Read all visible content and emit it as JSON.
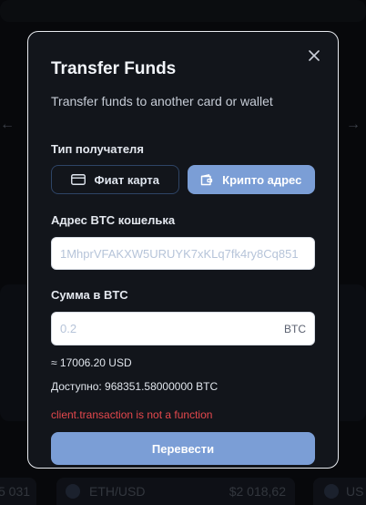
{
  "background": {
    "ticker_left": "5 031",
    "ticker_pair": "ETH/USD",
    "ticker_price": "$2 018,62",
    "ticker_right": "US"
  },
  "modal": {
    "title": "Transfer Funds",
    "subtitle": "Transfer funds to another card or wallet",
    "recipient_type_label": "Тип получателя",
    "type_options": [
      {
        "label": "Фиат карта",
        "icon": "credit-card-icon",
        "selected": false
      },
      {
        "label": "Крипто адрес",
        "icon": "wallet-icon",
        "selected": true
      }
    ],
    "address_label": "Адрес BTC кошелька",
    "address_placeholder": "1MhprVFAKXW5URUYK7xKLq7fk4ry8Cq851",
    "amount_label": "Сумма в BTC",
    "amount_placeholder": "0.2",
    "amount_unit": "BTC",
    "usd_equivalent": "≈ 17006.20 USD",
    "available": "Доступно: 968351.58000000 BTC",
    "error": "client.transaction is not a function",
    "submit_label": "Перевести"
  },
  "colors": {
    "accent": "#7b9ed6",
    "error": "#e5484d",
    "modal_bg": "#12151b"
  }
}
